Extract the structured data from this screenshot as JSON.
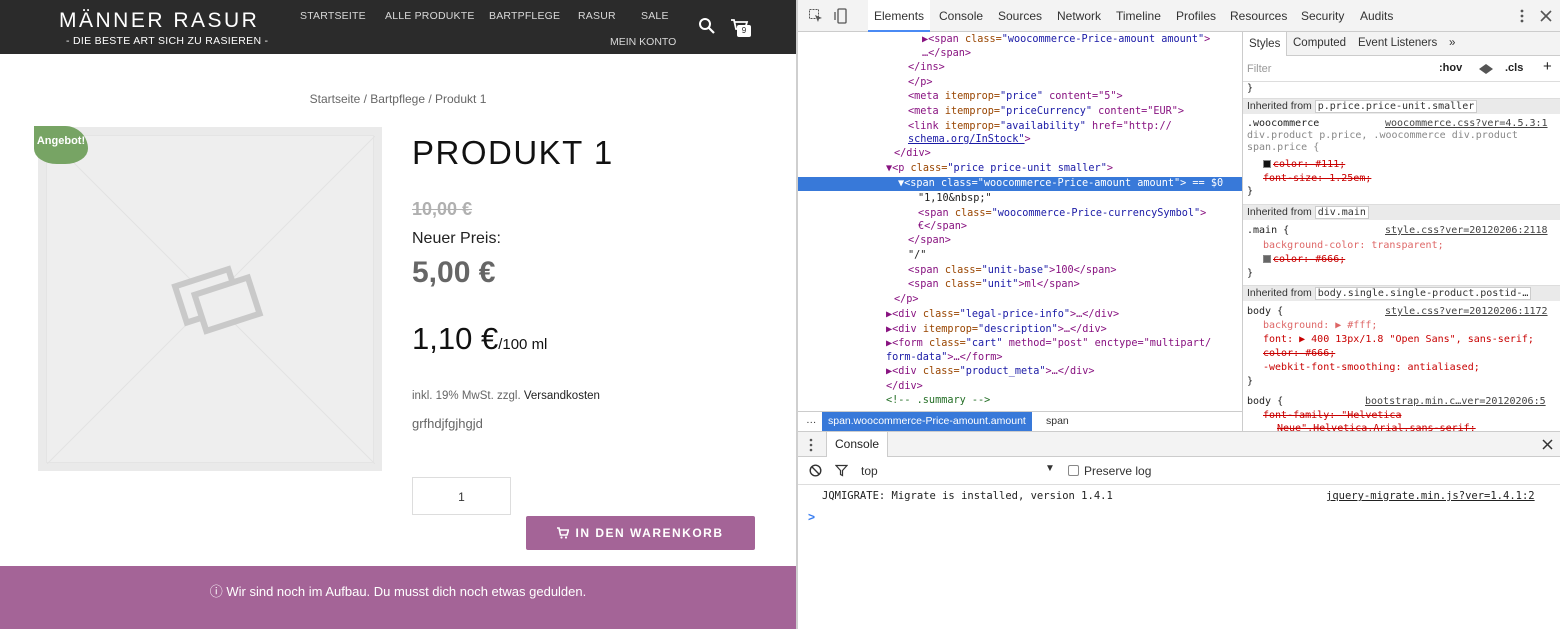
{
  "site": {
    "logo_title": "MÄNNER RASUR",
    "logo_subtitle": "- DIE BESTE ART SICH ZU RASIEREN -",
    "nav": [
      "STARTSEITE",
      "ALLE PRODUKTE",
      "BARTPFLEGE",
      "RASUR",
      "SALE"
    ],
    "nav_account": "MEIN KONTO",
    "cart_count": "9",
    "breadcrumb": "Startseite / Bartpflege / Produkt 1",
    "sale_badge": "Angebot!",
    "product_title": "PRODUKT 1",
    "old_price": "10,00 €",
    "new_price_label": "Neuer Preis:",
    "new_price": "5,00 €",
    "unit_price_value": "1,10 €",
    "unit_price_unit": "/100 ml",
    "tax_prefix": "inkl. 19% MwSt. zzgl. ",
    "tax_link": "Versandkosten",
    "description": "grfhdjfgjhgjd",
    "quantity": "1",
    "add_to_cart": "IN DEN WARENKORB",
    "notice": "ⓘ Wir sind noch im Aufbau. Du musst dich noch etwas gedulden.",
    "accent": "#a46497",
    "badge_color": "#77a464"
  },
  "devtools": {
    "tabs": [
      "Elements",
      "Console",
      "Sources",
      "Network",
      "Timeline",
      "Profiles",
      "Resources",
      "Security",
      "Audits"
    ],
    "dom_lines": [
      {
        "tag": "▶<span ",
        "attr": "class=",
        "val": "\"woocommerce-Price-amount amount\"",
        "end": ">"
      },
      {
        "tag": "",
        "attr": "",
        "val": "",
        "end": "…</span>"
      },
      {
        "tag": "</ins>",
        "attr": "",
        "val": "",
        "end": ""
      },
      {
        "tag": "</p>",
        "attr": "",
        "val": "",
        "end": ""
      },
      {
        "tag": "<meta ",
        "attr": "itemprop=",
        "val": "\"price\"",
        "end": " content=\"5\">"
      },
      {
        "tag": "<meta ",
        "attr": "itemprop=",
        "val": "\"priceCurrency\"",
        "end": " content=\"EUR\">"
      },
      {
        "tag": "<link ",
        "attr": "itemprop=",
        "val": "\"availability\"",
        "end": " href=\"http://"
      },
      {
        "tag": "",
        "attr": "",
        "val": "schema.org/InStock\"",
        "end": ">"
      },
      {
        "tag": "</div>",
        "attr": "",
        "val": "",
        "end": ""
      },
      {
        "tag": "▼<p ",
        "attr": "class=",
        "val": "\"price price-unit smaller\"",
        "end": ">"
      },
      {
        "tag": "▼<span ",
        "attr": "class=",
        "val": "\"woocommerce-Price-amount amount\"",
        "end": "> == $0"
      },
      {
        "tag": "",
        "attr": "",
        "val": "\"1,10&nbsp;\"",
        "end": ""
      },
      {
        "tag": "<span ",
        "attr": "class=",
        "val": "\"woocommerce-Price-currencySymbol\"",
        "end": ">"
      },
      {
        "tag": "",
        "attr": "",
        "val": "",
        "end": "€</span>"
      },
      {
        "tag": "</span>",
        "attr": "",
        "val": "",
        "end": ""
      },
      {
        "tag": "",
        "attr": "",
        "val": "\"/\"",
        "end": ""
      },
      {
        "tag": "<span ",
        "attr": "class=",
        "val": "\"unit-base\"",
        "end": ">100</span>"
      },
      {
        "tag": "<span ",
        "attr": "class=",
        "val": "\"unit\"",
        "end": ">ml</span>"
      },
      {
        "tag": "</p>",
        "attr": "",
        "val": "",
        "end": ""
      },
      {
        "tag": "▶<div ",
        "attr": "class=",
        "val": "\"legal-price-info\"",
        "end": ">…</div>"
      },
      {
        "tag": "▶<div ",
        "attr": "itemprop=",
        "val": "\"description\"",
        "end": ">…</div>"
      },
      {
        "tag": "▶<form ",
        "attr": "class=",
        "val": "\"cart\"",
        "end": " method=\"post\" enctype=\"multipart/"
      },
      {
        "tag": "",
        "attr": "",
        "val": "form-data\"",
        "end": ">…</form>"
      },
      {
        "tag": "▶<div ",
        "attr": "class=",
        "val": "\"product_meta\"",
        "end": ">…</div>"
      },
      {
        "tag": "</div>",
        "attr": "",
        "val": "",
        "end": ""
      },
      {
        "tag": "",
        "attr": "",
        "val": "",
        "end": "<!-- .summary -->"
      }
    ],
    "crumb_dots": "…",
    "crumb_active": "span.woocommerce-Price-amount.amount",
    "crumb_next": "span",
    "styles_tabs": [
      "Styles",
      "Computed",
      "Event Listeners",
      "»"
    ],
    "filter_placeholder": "Filter",
    "filter_hov": ":hov",
    "filter_cls": ".cls",
    "styles": {
      "inherited_label": "Inherited from",
      "sec1_chip": "p.price.price-unit.smaller",
      "sec1_selector_a": ".woocommerce",
      "sec1_src": "woocommerce.css?ver=4.5.3:1",
      "sec1_selector_b": "div.product p.price, .woocommerce div.product",
      "sec1_selector_c": "span.price {",
      "sec1_prop1": "color: #111;",
      "sec1_prop2": "font-size: 1.25em;",
      "sec2_chip": "div.main",
      "sec2_selector": ".main {",
      "sec2_src": "style.css?ver=20120206:2118",
      "sec2_prop1": "background-color: transparent;",
      "sec2_prop2": "color: #666;",
      "sec3_chip": "body.single.single-product.postid-…",
      "sec3_selector": "body {",
      "sec3_src": "style.css?ver=20120206:1172",
      "sec3_prop1": "background: ▶ #fff;",
      "sec3_prop2": "font: ▶ 400 13px/1.8 \"Open Sans\", sans-serif;",
      "sec3_prop3": "color: #666;",
      "sec3_prop4": "-webkit-font-smoothing: antialiased;",
      "sec4_selector": "body {",
      "sec4_src": "bootstrap.min.c…ver=20120206:5",
      "sec4_prop1": "font-family: \"Helvetica",
      "sec4_prop2": "Neue\",Helvetica,Arial,sans-serif;",
      "close_brace": "}"
    },
    "console": {
      "tab": "Console",
      "context": "top",
      "preserve_log": "Preserve log",
      "message": "JQMIGRATE: Migrate is installed, version 1.4.1",
      "source": "jquery-migrate.min.js?ver=1.4.1:2",
      "prompt": ">"
    },
    "selection_color": "#3879d9"
  }
}
